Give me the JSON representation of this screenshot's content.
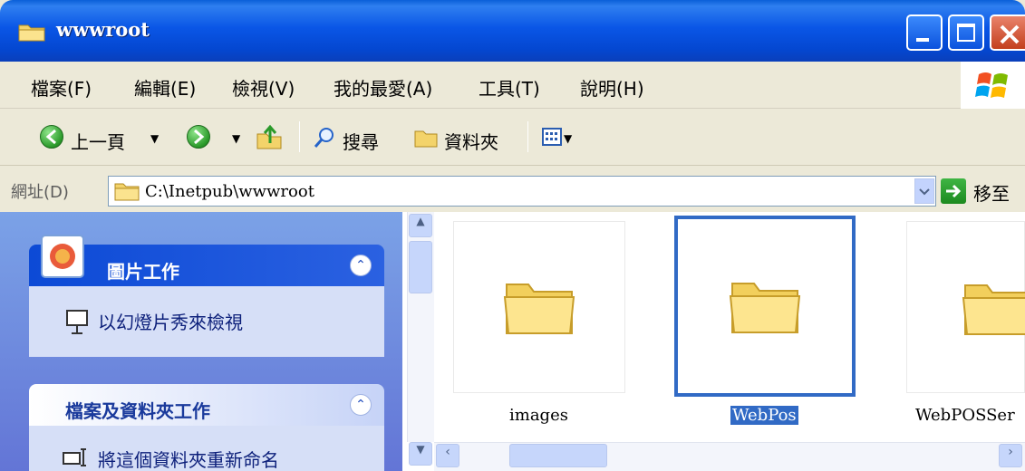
{
  "window": {
    "title": "wwwroot",
    "colors": {
      "titlebar": "#0a56e6",
      "selection": "#316ac5"
    }
  },
  "menu": {
    "items": [
      "檔案(F)",
      "編輯(E)",
      "檢視(V)",
      "我的最愛(A)",
      "工具(T)",
      "說明(H)"
    ]
  },
  "toolbar": {
    "back_label": "上一頁",
    "search_label": "搜尋",
    "folders_label": "資料夾"
  },
  "address": {
    "label": "網址(D)",
    "value": "C:\\Inetpub\\wwwroot",
    "go_label": "移至"
  },
  "taskpane": {
    "picture_tasks": {
      "title": "圖片工作",
      "items": [
        "以幻燈片秀來檢視"
      ]
    },
    "file_tasks": {
      "title": "檔案及資料夾工作",
      "items": [
        "將這個資料夾重新命名"
      ]
    }
  },
  "files": [
    {
      "name": "images",
      "selected": false
    },
    {
      "name": "WebPos",
      "selected": true
    },
    {
      "name": "WebPOSSer",
      "selected": false
    }
  ]
}
